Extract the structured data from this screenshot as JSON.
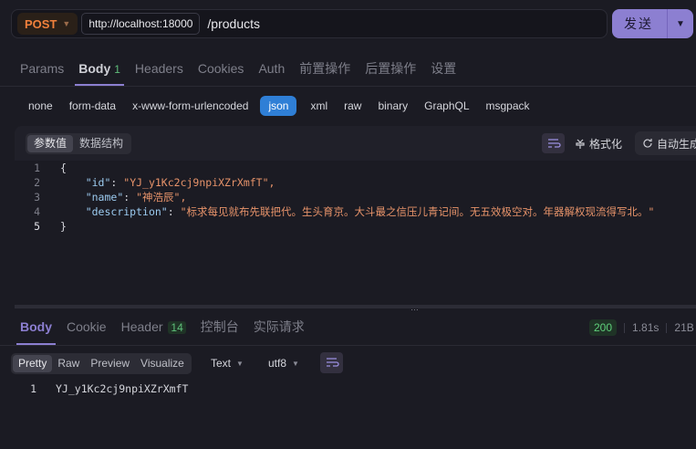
{
  "url_bar": {
    "method": "POST",
    "host": "http://localhost:18000",
    "path": "/products",
    "send_label": "发送"
  },
  "request_tabs": [
    {
      "label": "Params"
    },
    {
      "label": "Body",
      "count": "1"
    },
    {
      "label": "Headers"
    },
    {
      "label": "Cookies"
    },
    {
      "label": "Auth"
    },
    {
      "label": "前置操作"
    },
    {
      "label": "后置操作"
    },
    {
      "label": "设置"
    }
  ],
  "body_types": [
    "none",
    "form-data",
    "x-www-form-urlencoded",
    "json",
    "xml",
    "raw",
    "binary",
    "GraphQL",
    "msgpack"
  ],
  "editor": {
    "tabs": [
      "参数值",
      "数据结构"
    ],
    "format_label": "格式化",
    "autogen_label": "自动生成",
    "lines": [
      "1",
      "2",
      "3",
      "4",
      "5"
    ],
    "open_brace": "{",
    "close_brace": "}",
    "fields": [
      {
        "key": "\"id\"",
        "value": "\"YJ_y1Kc2cj9npiXZrXmfT\","
      },
      {
        "key": "\"name\"",
        "value": "\"神浩辰\","
      },
      {
        "key": "\"description\"",
        "value": "\"标求每见就布先联把代。生头育京。大斗最之信压儿青记间。无五效极空对。年器解权现流得写北。\""
      }
    ]
  },
  "response": {
    "tabs": [
      {
        "label": "Body"
      },
      {
        "label": "Cookie"
      },
      {
        "label": "Header",
        "count": "14"
      },
      {
        "label": "控制台"
      },
      {
        "label": "实际请求"
      }
    ],
    "status_code": "200",
    "time": "1.81s",
    "size": "21B",
    "view_modes": [
      "Pretty",
      "Raw",
      "Preview",
      "Visualize"
    ],
    "format": "Text",
    "encoding": "utf8",
    "line_number": "1",
    "body_text": "YJ_y1Kc2cj9npiXZrXmfT"
  },
  "colors": {
    "accent": "#8c7fd1",
    "method": "#f0803c",
    "json_active": "#2f7fd6",
    "status_ok": "#5fd07b"
  }
}
